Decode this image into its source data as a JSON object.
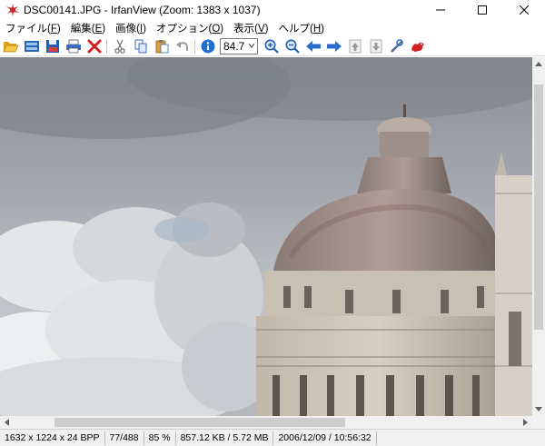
{
  "window": {
    "title": "DSC00141.JPG - IrfanView (Zoom: 1383 x 1037)",
    "minimize": "—",
    "maximize": "☐",
    "close": "✕"
  },
  "menu": [
    {
      "label": "ファイル(",
      "key": "F",
      "end": ")"
    },
    {
      "label": "編集(",
      "key": "E",
      "end": ")"
    },
    {
      "label": "画像(",
      "key": "I",
      "end": ")"
    },
    {
      "label": "オプション(",
      "key": "O",
      "end": ")"
    },
    {
      "label": "表示(",
      "key": "V",
      "end": ")"
    },
    {
      "label": "ヘルプ(",
      "key": "H",
      "end": ")"
    }
  ],
  "toolbar": {
    "zoom_value": "84.7",
    "icons": [
      "open-folder-icon",
      "thumbnails-icon",
      "save-icon",
      "print-icon",
      "delete-icon",
      "cut-icon",
      "copy-icon",
      "paste-icon",
      "undo-icon",
      "info-icon",
      "zoom-in-icon",
      "zoom-out-icon",
      "previous-icon",
      "next-icon",
      "previous-page-icon",
      "next-page-icon",
      "properties-icon",
      "irfanview-logo-icon"
    ]
  },
  "status": {
    "dimensions": "1632 x 1224 x 24 BPP",
    "index": "77/488",
    "zoom": "85 %",
    "filesize": "857.12 KB / 5.72 MB",
    "datetime": "2006/12/09 / 10:56:32"
  },
  "colors": {
    "accent_blue": "#1e6fd0",
    "red": "#d42020",
    "sky": "#9ea3a9"
  }
}
